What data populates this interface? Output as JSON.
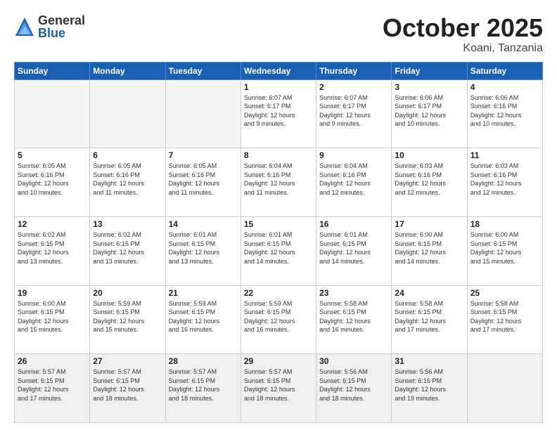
{
  "header": {
    "logo_general": "General",
    "logo_blue": "Blue",
    "month_title": "October 2025",
    "location": "Koani, Tanzania"
  },
  "weekdays": [
    "Sunday",
    "Monday",
    "Tuesday",
    "Wednesday",
    "Thursday",
    "Friday",
    "Saturday"
  ],
  "weeks": [
    [
      {
        "day": "",
        "info": ""
      },
      {
        "day": "",
        "info": ""
      },
      {
        "day": "",
        "info": ""
      },
      {
        "day": "1",
        "info": "Sunrise: 6:07 AM\nSunset: 6:17 PM\nDaylight: 12 hours\nand 9 minutes."
      },
      {
        "day": "2",
        "info": "Sunrise: 6:07 AM\nSunset: 6:17 PM\nDaylight: 12 hours\nand 9 minutes."
      },
      {
        "day": "3",
        "info": "Sunrise: 6:06 AM\nSunset: 6:17 PM\nDaylight: 12 hours\nand 10 minutes."
      },
      {
        "day": "4",
        "info": "Sunrise: 6:06 AM\nSunset: 6:16 PM\nDaylight: 12 hours\nand 10 minutes."
      }
    ],
    [
      {
        "day": "5",
        "info": "Sunrise: 6:05 AM\nSunset: 6:16 PM\nDaylight: 12 hours\nand 10 minutes."
      },
      {
        "day": "6",
        "info": "Sunrise: 6:05 AM\nSunset: 6:16 PM\nDaylight: 12 hours\nand 11 minutes."
      },
      {
        "day": "7",
        "info": "Sunrise: 6:05 AM\nSunset: 6:16 PM\nDaylight: 12 hours\nand 11 minutes."
      },
      {
        "day": "8",
        "info": "Sunrise: 6:04 AM\nSunset: 6:16 PM\nDaylight: 12 hours\nand 11 minutes."
      },
      {
        "day": "9",
        "info": "Sunrise: 6:04 AM\nSunset: 6:16 PM\nDaylight: 12 hours\nand 12 minutes."
      },
      {
        "day": "10",
        "info": "Sunrise: 6:03 AM\nSunset: 6:16 PM\nDaylight: 12 hours\nand 12 minutes."
      },
      {
        "day": "11",
        "info": "Sunrise: 6:03 AM\nSunset: 6:16 PM\nDaylight: 12 hours\nand 12 minutes."
      }
    ],
    [
      {
        "day": "12",
        "info": "Sunrise: 6:02 AM\nSunset: 6:15 PM\nDaylight: 12 hours\nand 13 minutes."
      },
      {
        "day": "13",
        "info": "Sunrise: 6:02 AM\nSunset: 6:15 PM\nDaylight: 12 hours\nand 13 minutes."
      },
      {
        "day": "14",
        "info": "Sunrise: 6:01 AM\nSunset: 6:15 PM\nDaylight: 12 hours\nand 13 minutes."
      },
      {
        "day": "15",
        "info": "Sunrise: 6:01 AM\nSunset: 6:15 PM\nDaylight: 12 hours\nand 14 minutes."
      },
      {
        "day": "16",
        "info": "Sunrise: 6:01 AM\nSunset: 6:15 PM\nDaylight: 12 hours\nand 14 minutes."
      },
      {
        "day": "17",
        "info": "Sunrise: 6:00 AM\nSunset: 6:15 PM\nDaylight: 12 hours\nand 14 minutes."
      },
      {
        "day": "18",
        "info": "Sunrise: 6:00 AM\nSunset: 6:15 PM\nDaylight: 12 hours\nand 15 minutes."
      }
    ],
    [
      {
        "day": "19",
        "info": "Sunrise: 6:00 AM\nSunset: 6:15 PM\nDaylight: 12 hours\nand 15 minutes."
      },
      {
        "day": "20",
        "info": "Sunrise: 5:59 AM\nSunset: 6:15 PM\nDaylight: 12 hours\nand 15 minutes."
      },
      {
        "day": "21",
        "info": "Sunrise: 5:59 AM\nSunset: 6:15 PM\nDaylight: 12 hours\nand 16 minutes."
      },
      {
        "day": "22",
        "info": "Sunrise: 5:59 AM\nSunset: 6:15 PM\nDaylight: 12 hours\nand 16 minutes."
      },
      {
        "day": "23",
        "info": "Sunrise: 5:58 AM\nSunset: 6:15 PM\nDaylight: 12 hours\nand 16 minutes."
      },
      {
        "day": "24",
        "info": "Sunrise: 5:58 AM\nSunset: 6:15 PM\nDaylight: 12 hours\nand 17 minutes."
      },
      {
        "day": "25",
        "info": "Sunrise: 5:58 AM\nSunset: 6:15 PM\nDaylight: 12 hours\nand 17 minutes."
      }
    ],
    [
      {
        "day": "26",
        "info": "Sunrise: 5:57 AM\nSunset: 6:15 PM\nDaylight: 12 hours\nand 17 minutes."
      },
      {
        "day": "27",
        "info": "Sunrise: 5:57 AM\nSunset: 6:15 PM\nDaylight: 12 hours\nand 18 minutes."
      },
      {
        "day": "28",
        "info": "Sunrise: 5:57 AM\nSunset: 6:15 PM\nDaylight: 12 hours\nand 18 minutes."
      },
      {
        "day": "29",
        "info": "Sunrise: 5:57 AM\nSunset: 6:15 PM\nDaylight: 12 hours\nand 18 minutes."
      },
      {
        "day": "30",
        "info": "Sunrise: 5:56 AM\nSunset: 6:15 PM\nDaylight: 12 hours\nand 18 minutes."
      },
      {
        "day": "31",
        "info": "Sunrise: 5:56 AM\nSunset: 6:16 PM\nDaylight: 12 hours\nand 19 minutes."
      },
      {
        "day": "",
        "info": ""
      }
    ]
  ]
}
